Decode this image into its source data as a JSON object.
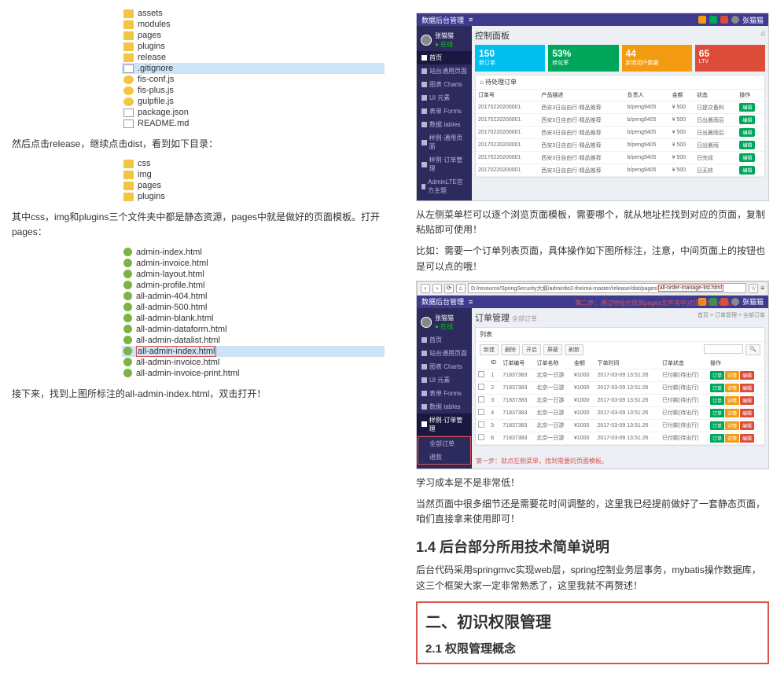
{
  "left": {
    "tree1": [
      {
        "type": "folder",
        "name": "assets"
      },
      {
        "type": "folder",
        "name": "modules"
      },
      {
        "type": "folder",
        "name": "pages"
      },
      {
        "type": "folder",
        "name": "plugins"
      },
      {
        "type": "folder",
        "name": "release"
      },
      {
        "type": "file",
        "name": ".gitignore",
        "hl": true
      },
      {
        "type": "js",
        "name": "fis-conf.js"
      },
      {
        "type": "js",
        "name": "fis-plus.js"
      },
      {
        "type": "js",
        "name": "gulpfile.js"
      },
      {
        "type": "file",
        "name": "package.json"
      },
      {
        "type": "file",
        "name": "README.md"
      }
    ],
    "para1": "然后点击release，继续点击dist，看到如下目录：",
    "tree2": [
      {
        "type": "folder",
        "name": "css"
      },
      {
        "type": "folder",
        "name": "img"
      },
      {
        "type": "folder",
        "name": "pages"
      },
      {
        "type": "folder",
        "name": "plugins"
      }
    ],
    "para2": "其中css，img和plugins三个文件夹中都是静态资源，pages中就是做好的页面模板。打开pages：",
    "tree3": [
      {
        "type": "html",
        "name": "admin-index.html"
      },
      {
        "type": "html",
        "name": "admin-invoice.html"
      },
      {
        "type": "html",
        "name": "admin-layout.html"
      },
      {
        "type": "html",
        "name": "admin-profile.html"
      },
      {
        "type": "html",
        "name": "all-admin-404.html"
      },
      {
        "type": "html",
        "name": "all-admin-500.html"
      },
      {
        "type": "html",
        "name": "all-admin-blank.html"
      },
      {
        "type": "html",
        "name": "all-admin-dataform.html"
      },
      {
        "type": "html",
        "name": "all-admin-datalist.html"
      },
      {
        "type": "html",
        "name": "all-admin-index.html",
        "hl": true,
        "red": true
      },
      {
        "type": "html",
        "name": "all-admin-invoice.html"
      },
      {
        "type": "html",
        "name": "all-admin-invoice-print.html"
      }
    ],
    "para3": "接下来，找到上图所标注的all-admin-index.html，双击打开！"
  },
  "right": {
    "admin1": {
      "logo": "数据后台管理",
      "user": "张猫猫",
      "role": "在线",
      "sidebar": [
        "首页",
        "站台通用页面",
        "图表 Charts",
        "UI 元素",
        "表单 Forms",
        "数据 tables",
        "样例·通用页面",
        "样例·订单管理",
        "AdminLTE官方主题"
      ],
      "title": "控制面板",
      "cards": [
        {
          "num": "150",
          "lbl": "新订单",
          "cls": "c-blue"
        },
        {
          "num": "53%",
          "lbl": "转化率",
          "cls": "c-green"
        },
        {
          "num": "44",
          "lbl": "新增用户数量",
          "cls": "c-yellow"
        },
        {
          "num": "65",
          "lbl": "LTV",
          "cls": "c-red"
        }
      ],
      "panel_title": "待处理订单",
      "headers": [
        "订单号",
        "产品描述",
        "负责人",
        "金额",
        "状态",
        "操作"
      ],
      "rows": [
        {
          "id": "20170220200001",
          "prod": "西安3日自由行·精品推荐",
          "user": "b/peng9405",
          "amt": "¥ 500",
          "status": "已提交备料",
          "op": "编辑"
        },
        {
          "id": "20170220200001",
          "prod": "西安3日自由行·精品推荐",
          "user": "b/peng9405",
          "amt": "¥ 500",
          "status": "日出晨雨后",
          "op": "编辑"
        },
        {
          "id": "20170220200001",
          "prod": "西安3日自由行·精品推荐",
          "user": "b/peng9405",
          "amt": "¥ 500",
          "status": "日出晨雨后",
          "op": "编辑"
        },
        {
          "id": "20170220200001",
          "prod": "西安3日自由行·精品推荐",
          "user": "b/peng9405",
          "amt": "¥ 500",
          "status": "日出晨雨",
          "op": "编辑"
        },
        {
          "id": "20170220200001",
          "prod": "西安3日自由行·精品推荐",
          "user": "b/peng9405",
          "amt": "¥ 500",
          "status": "日完成",
          "op": "编辑"
        },
        {
          "id": "20170220200001",
          "prod": "西安3日自由行·精品推荐",
          "user": "b/peng9405",
          "amt": "¥ 500",
          "status": "日无效",
          "op": "编辑"
        }
      ]
    },
    "para_r1": "从左侧菜单栏可以逐个浏览页面模板，需要哪个，就从地址栏找到对应的页面，复制粘贴即可使用！",
    "para_r2": "比如：需要一个订单列表页面，具体操作如下图所标注，注意，中间页面上的按钮也是可以点的哦！",
    "url_prefix": "D:/resource/SpringSecurity大纲/adminlte2-theima-master/release/dist/pages/",
    "url_highlight": "all-order-manage-list.html",
    "step2_note": "第二步：通过地址栏找到pages文件夹中对应的页面模板。",
    "step1_note": "第一步：就点左侧菜单，找到需要的页面模板。",
    "admin2": {
      "logo": "数据后台管理",
      "user": "张猫猫",
      "role": "在线",
      "sidebar_top": [
        "首页",
        "站台通用页面",
        "图表 Charts",
        "UI 元素",
        "表单 Forms",
        "数据 tables",
        "样例·订单管理"
      ],
      "sidebar_red": [
        "全部订单",
        "退款"
      ],
      "title": "订单管理",
      "subtitle": "全部订单",
      "crumb_right": "首页 > 订单管理 > 全部订单",
      "panel_title": "列表",
      "toolbar": [
        "新建",
        "删除",
        "开启",
        "屏蔽",
        "刷新"
      ],
      "headers": [
        "",
        "ID",
        "订单编号",
        "订单名称",
        "金额",
        "下单时间",
        "订单状态",
        "操作"
      ],
      "rows": [
        {
          "n": "1",
          "id": "71837383",
          "name": "北京一日游",
          "amt": "¥1000",
          "time": "2017-03-09 13:51:26",
          "status": "已付款(待出行)"
        },
        {
          "n": "2",
          "id": "71837383",
          "name": "北京一日游",
          "amt": "¥1000",
          "time": "2017-03-09 13:51:26",
          "status": "已付款(待出行)"
        },
        {
          "n": "3",
          "id": "71837383",
          "name": "北京一日游",
          "amt": "¥1000",
          "time": "2017-03-09 13:51:26",
          "status": "已付款(待出行)"
        },
        {
          "n": "4",
          "id": "71837383",
          "name": "北京一日游",
          "amt": "¥1000",
          "time": "2017-03-09 13:51:26",
          "status": "已付款(待出行)"
        },
        {
          "n": "5",
          "id": "71837383",
          "name": "北京一日游",
          "amt": "¥1000",
          "time": "2017-03-09 13:51:26",
          "status": "已付款(待出行)"
        },
        {
          "n": "6",
          "id": "71837383",
          "name": "北京一日游",
          "amt": "¥1000",
          "time": "2017-03-09 13:51:26",
          "status": "已付款(待出行)"
        }
      ],
      "actions": [
        "订单",
        "详情",
        "编辑"
      ]
    },
    "para_r3": "学习成本是不是非常低！",
    "para_r4": "当然页面中很多细节还是需要花时间调整的，这里我已经提前做好了一套静态页面，咱们直接拿来使用即可！",
    "h14": "1.4 后台部分所用技术简单说明",
    "para_r5": "后台代码采用springmvc实现web层，spring控制业务层事务，mybatis操作数据库，这三个框架大家一定非常熟悉了，这里我就不再赘述！",
    "h2": "二、初识权限管理",
    "h21": "2.1 权限管理概念"
  }
}
